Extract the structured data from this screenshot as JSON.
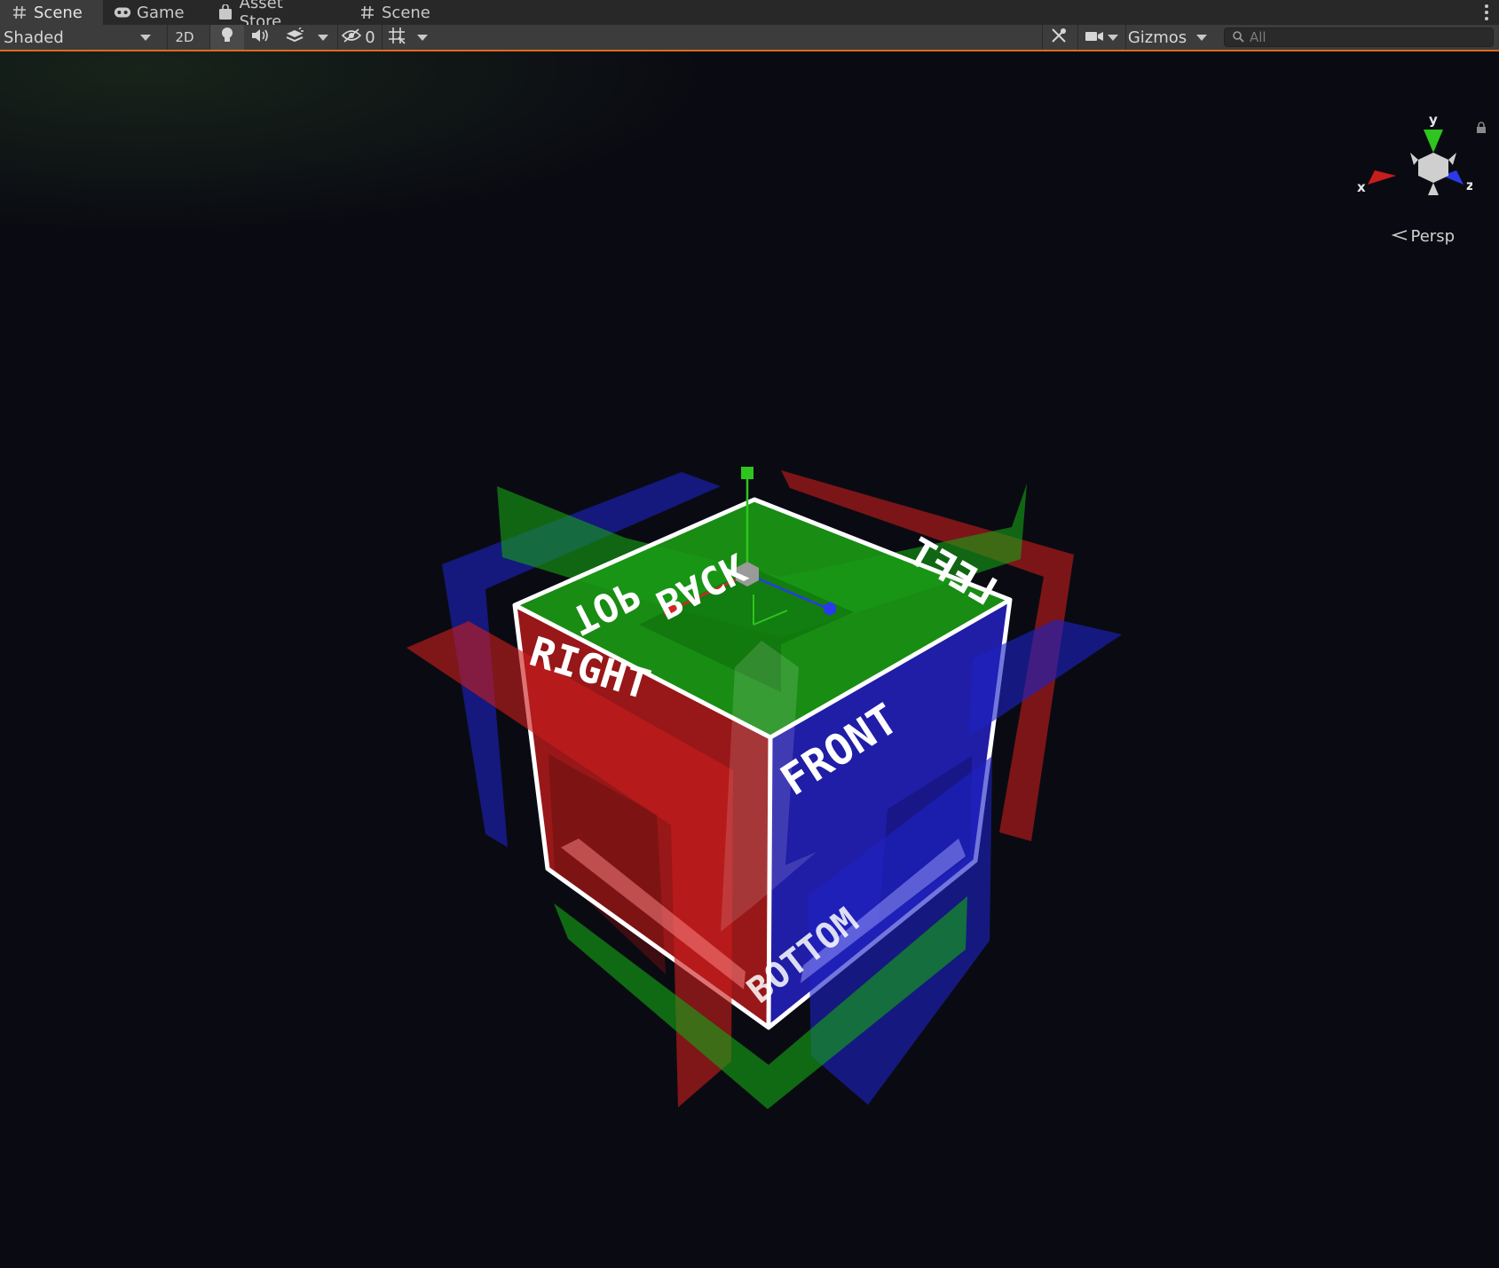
{
  "tabs": [
    {
      "label": "Scene",
      "icon": "hash-icon",
      "active": true
    },
    {
      "label": "Game",
      "icon": "gamepad-icon",
      "active": false
    },
    {
      "label": "Asset Store",
      "icon": "shopping-bag-icon",
      "active": false
    },
    {
      "label": "Scene",
      "icon": "hash-icon",
      "active": false
    }
  ],
  "toolbar": {
    "draw_mode": "Shaded",
    "toggle_2d": "2D",
    "hidden_count": "0",
    "gizmos_label": "Gizmos",
    "search_placeholder": "All"
  },
  "orientation_gizmo": {
    "axis_y": "y",
    "axis_x": "x",
    "axis_z": "z",
    "projection": "Persp"
  },
  "cube_faces": {
    "top": "TOP",
    "back": "BACK",
    "left": "LEFT",
    "right": "RIGHT",
    "front": "FRONT",
    "bottom": "BOTTOM"
  },
  "colors": {
    "x_axis": "#d42424",
    "y_axis": "#2ec51e",
    "z_axis": "#2a3be6",
    "accent": "#e06a1c",
    "background": "#0a0b12"
  }
}
